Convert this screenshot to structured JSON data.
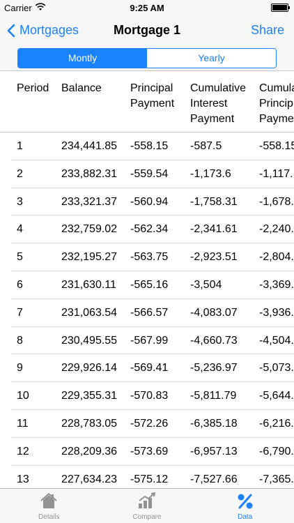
{
  "status_bar": {
    "carrier": "Carrier",
    "time": "9:25 AM"
  },
  "nav": {
    "back_label": "Mortgages",
    "title": "Mortgage 1",
    "share_label": "Share"
  },
  "segments": {
    "monthly": "Montly",
    "yearly": "Yearly",
    "selected": "monthly"
  },
  "table": {
    "headers": [
      [
        "Period"
      ],
      [
        "Balance"
      ],
      [
        "Principal",
        "Payment"
      ],
      [
        "Cumulative",
        "Interest",
        "Payment"
      ],
      [
        "Cumula",
        "Princip",
        "Payme"
      ]
    ],
    "rows": [
      [
        "1",
        "234,441.85",
        "-558.15",
        "-587.5",
        "-558.15"
      ],
      [
        "2",
        "233,882.31",
        "-559.54",
        "-1,173.6",
        "-1,117."
      ],
      [
        "3",
        "233,321.37",
        "-560.94",
        "-1,758.31",
        "-1,678."
      ],
      [
        "4",
        "232,759.02",
        "-562.34",
        "-2,341.61",
        "-2,240."
      ],
      [
        "5",
        "232,195.27",
        "-563.75",
        "-2,923.51",
        "-2,804."
      ],
      [
        "6",
        "231,630.11",
        "-565.16",
        "-3,504",
        "-3,369."
      ],
      [
        "7",
        "231,063.54",
        "-566.57",
        "-4,083.07",
        "-3,936."
      ],
      [
        "8",
        "230,495.55",
        "-567.99",
        "-4,660.73",
        "-4,504."
      ],
      [
        "9",
        "229,926.14",
        "-569.41",
        "-5,236.97",
        "-5,073."
      ],
      [
        "10",
        "229,355.31",
        "-570.83",
        "-5,811.79",
        "-5,644."
      ],
      [
        "11",
        "228,783.05",
        "-572.26",
        "-6,385.18",
        "-6,216."
      ],
      [
        "12",
        "228,209.36",
        "-573.69",
        "-6,957.13",
        "-6,790."
      ],
      [
        "13",
        "227,634.23",
        "-575.12",
        "-7,527.66",
        "-7,365."
      ]
    ]
  },
  "tabs": [
    {
      "label": "Details",
      "icon": "house-icon"
    },
    {
      "label": "Compare",
      "icon": "bar-chart-icon"
    },
    {
      "label": "Data",
      "icon": "percent-icon",
      "selected": true
    }
  ],
  "colors": {
    "accent": "#1a82fb",
    "inactive_tab": "#929292",
    "separator": "#c8c7cc"
  }
}
